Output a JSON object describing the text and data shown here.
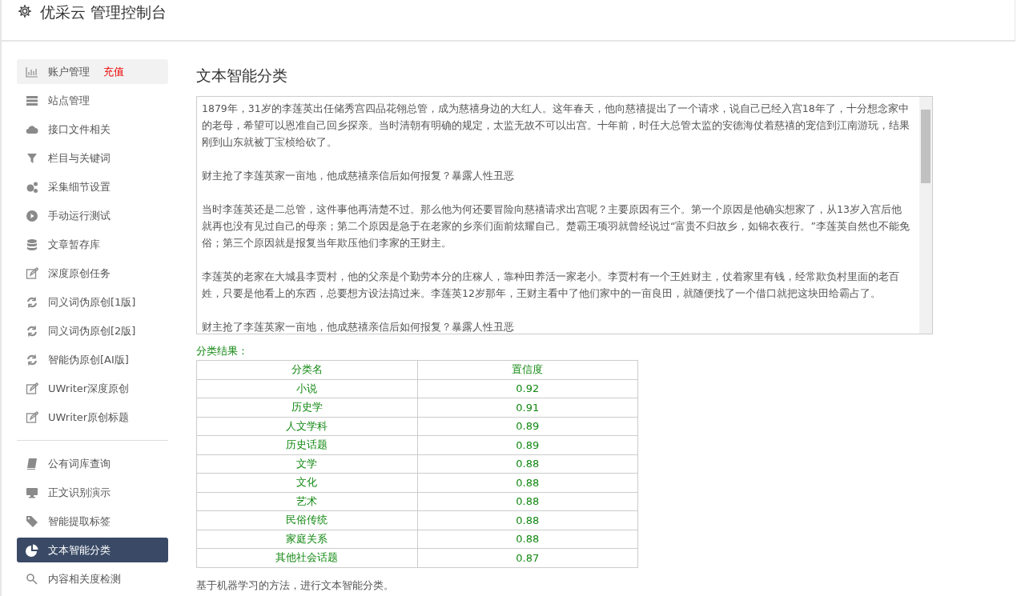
{
  "header": {
    "title": "优采云 管理控制台"
  },
  "sidebar": {
    "groups": [
      {
        "items": [
          {
            "label": "账户管理",
            "badge": "充值",
            "hovered": true,
            "selected": false
          },
          {
            "label": "站点管理",
            "hovered": false,
            "selected": false
          },
          {
            "label": "接口文件相关",
            "hovered": false,
            "selected": false
          },
          {
            "label": "栏目与关键词",
            "hovered": false,
            "selected": false
          },
          {
            "label": "采集细节设置",
            "hovered": false,
            "selected": false
          },
          {
            "label": "手动运行测试",
            "hovered": false,
            "selected": false
          },
          {
            "label": "文章暂存库",
            "hovered": false,
            "selected": false
          },
          {
            "label": "深度原创任务",
            "hovered": false,
            "selected": false
          },
          {
            "label": "同义词伪原创[1版]",
            "hovered": false,
            "selected": false
          },
          {
            "label": "同义词伪原创[2版]",
            "hovered": false,
            "selected": false
          },
          {
            "label": "智能伪原创[AI版]",
            "hovered": false,
            "selected": false
          },
          {
            "label": "UWriter深度原创",
            "hovered": false,
            "selected": false
          },
          {
            "label": "UWriter原创标题",
            "hovered": false,
            "selected": false
          }
        ]
      },
      {
        "items": [
          {
            "label": "公有词库查询",
            "hovered": false,
            "selected": false
          },
          {
            "label": "正文识别演示",
            "hovered": false,
            "selected": false
          },
          {
            "label": "智能提取标签",
            "hovered": false,
            "selected": false
          },
          {
            "label": "文本智能分类",
            "hovered": false,
            "selected": true
          },
          {
            "label": "内容相关度检测",
            "hovered": false,
            "selected": false
          }
        ]
      }
    ]
  },
  "main": {
    "title": "文本智能分类",
    "text_input": {
      "paragraphs": [
        "1879年，31岁的李莲英出任储秀宫四品花翎总管，成为慈禧身边的大红人。这年春天，他向慈禧提出了一个请求，说自己已经入宫18年了，十分想念家中的老母，希望可以恩准自己回乡探亲。当时清朝有明确的规定，太监无故不可以出宫。十年前，时任大总管太监的安德海仗着慈禧的宠信到江南游玩，结果刚到山东就被丁宝桢给砍了。",
        "财主抢了李莲英家一亩地，他成慈禧亲信后如何报复？暴露人性丑恶",
        "当时李莲英还是二总管，这件事他再清楚不过。那么他为何还要冒险向慈禧请求出宫呢？主要原因有三个。第一个原因是他确实想家了，从13岁入宫后他就再也没有见过自己的母亲；第二个原因是急于在老家的乡亲们面前炫耀自己。楚霸王项羽就曾经说过“富贵不归故乡，如锦衣夜行。”李莲英自然也不能免俗；第三个原因就是报复当年欺压他们李家的王财主。",
        "李莲英的老家在大城县李贾村，他的父亲是个勤劳本分的庄稼人，靠种田养活一家老小。李贾村有一个王姓财主，仗着家里有钱，经常欺负村里面的老百姓，只要是他看上的东西，总要想方设法搞过来。李莲英12岁那年，王财主看中了他们家中的一亩良田，就随便找了一个借口就把这块田给霸占了。",
        "财主抢了李莲英家一亩地，他成慈禧亲信后如何报复？暴露人性丑恶"
      ]
    },
    "result_label": "分类结果：",
    "table": {
      "columns": [
        "分类名",
        "置信度"
      ],
      "rows": [
        [
          "小说",
          "0.92"
        ],
        [
          "历史学",
          "0.91"
        ],
        [
          "人文学科",
          "0.89"
        ],
        [
          "历史话题",
          "0.89"
        ],
        [
          "文学",
          "0.88"
        ],
        [
          "文化",
          "0.88"
        ],
        [
          "艺术",
          "0.88"
        ],
        [
          "民俗传统",
          "0.88"
        ],
        [
          "家庭关系",
          "0.88"
        ],
        [
          "其他社会话题",
          "0.87"
        ]
      ]
    },
    "note": "基于机器学习的方法，进行文本智能分类。"
  }
}
